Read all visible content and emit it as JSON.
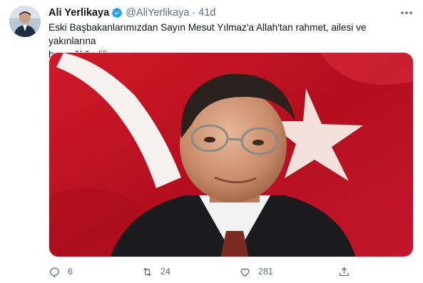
{
  "tweet": {
    "author": {
      "display_name": "Ali Yerlikaya",
      "handle": "@AliYerlikaya",
      "verified_icon": "verified-badge-icon"
    },
    "separator": "·",
    "timestamp": "41d",
    "text": "Eski Başbakanlarımızdan Sayın Mesut Yılmaz'a Allah'tan rahmet, ailesi ve yakınlarına\nbaşsağlığı diliyorum.",
    "media": {
      "icon": "photo-image",
      "dominant_colors": [
        "#c8102e",
        "#ffffff"
      ]
    },
    "actions": {
      "reply": {
        "icon": "reply-icon",
        "count": "6"
      },
      "retweet": {
        "icon": "retweet-icon",
        "count": "24"
      },
      "like": {
        "icon": "heart-icon",
        "count": "281"
      },
      "share": {
        "icon": "share-icon"
      }
    }
  },
  "colors": {
    "accent": "#1da1f2",
    "muted": "#5b7083",
    "text": "#0f1419"
  }
}
